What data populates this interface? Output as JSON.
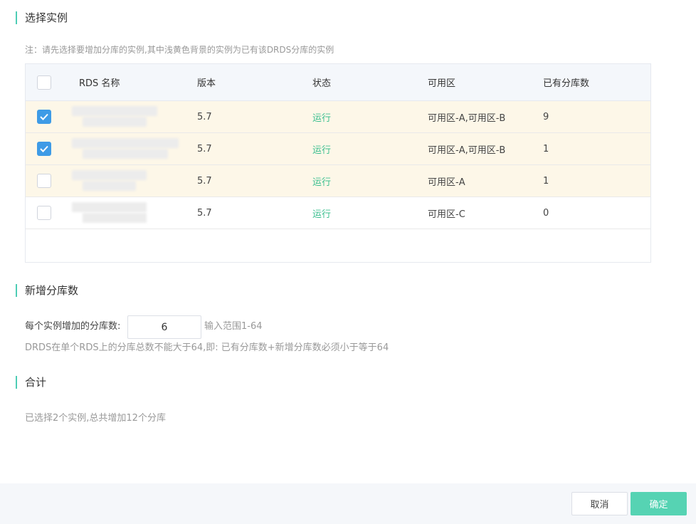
{
  "sections": {
    "select_instance": "选择实例",
    "add_shards": "新增分库数",
    "total": "合计"
  },
  "note": "注：请先选择要增加分库的实例,其中浅黄色背景的实例为已有该DRDS分库的实例",
  "table": {
    "headers": {
      "name": "RDS 名称",
      "version": "版本",
      "status": "状态",
      "zone": "可用区",
      "shard_count": "已有分库数"
    },
    "rows": [
      {
        "version": "5.7",
        "status": "运行",
        "zone": "可用区-A,可用区-B",
        "shard_count": "9",
        "checked": true,
        "highlight": true
      },
      {
        "version": "5.7",
        "status": "运行",
        "zone": "可用区-A,可用区-B",
        "shard_count": "1",
        "checked": true,
        "highlight": true
      },
      {
        "version": "5.7",
        "status": "运行",
        "zone": "可用区-A",
        "shard_count": "1",
        "checked": false,
        "highlight": true
      },
      {
        "version": "5.7",
        "status": "运行",
        "zone": "可用区-C",
        "shard_count": "0",
        "checked": false,
        "highlight": false
      }
    ]
  },
  "shard_form": {
    "label": "每个实例增加的分库数:",
    "value": "6",
    "range_hint": "输入范围1-64",
    "rule_hint": "DRDS在单个RDS上的分库总数不能大于64,即: 已有分库数+新增分库数必须小于等于64"
  },
  "summary": "已选择2个实例,总共增加12个分库",
  "buttons": {
    "cancel": "取消",
    "ok": "确定"
  },
  "colors": {
    "accent": "#4ecdb5",
    "checkbox_checked": "#3e9be6",
    "status_running": "#3bbf8f",
    "highlight_row": "#fdf7e8",
    "ok_button": "#56d3b3"
  }
}
